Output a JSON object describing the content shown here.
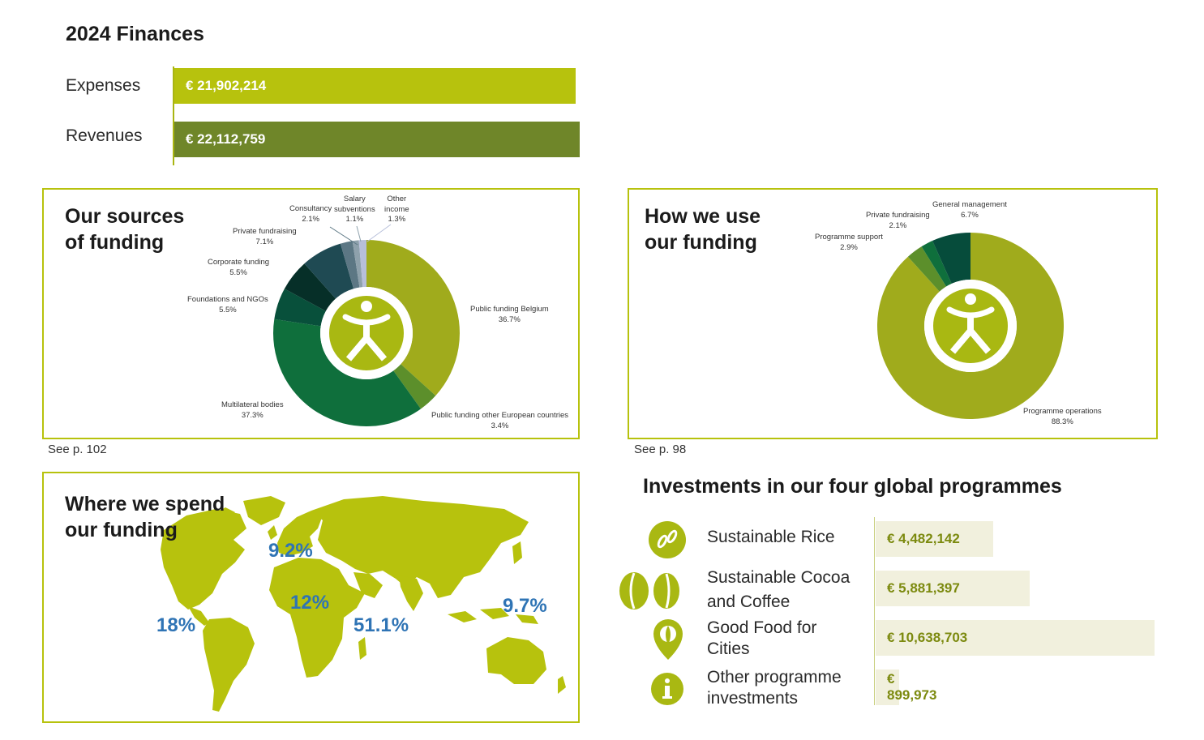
{
  "finances": {
    "title": "2024 Finances",
    "expenses_label": "Expenses",
    "expenses_value": "€ 21,902,214",
    "revenues_label": "Revenues",
    "revenues_value": "€ 22,112,759",
    "colors": {
      "expenses": "#b7c20d",
      "revenues": "#6f8629"
    }
  },
  "sources": {
    "title_line1": "Our sources",
    "title_line2": "of funding",
    "see": "See p. 102"
  },
  "use": {
    "title_line1": "How we use",
    "title_line2": "our funding",
    "see": "See p. 98"
  },
  "spend": {
    "title_line1": "Where we spend",
    "title_line2": "our funding",
    "regions": [
      {
        "name": "Americas",
        "value": "18%"
      },
      {
        "name": "Europe",
        "value": "9.2%"
      },
      {
        "name": "West Africa",
        "value": "12%"
      },
      {
        "name": "East Africa",
        "value": "51.1%"
      },
      {
        "name": "Asia",
        "value": "9.7%"
      }
    ]
  },
  "investments": {
    "title": "Investments in our four global programmes",
    "items": [
      {
        "label_line1": "Sustainable Rice",
        "label_line2": "",
        "value": "€ 4,482,142",
        "amount": 4482142,
        "icon": "rice-grain-icon"
      },
      {
        "label_line1": "Sustainable Cocoa",
        "label_line2": "and Coffee",
        "value": "€ 5,881,397",
        "amount": 5881397,
        "icon": "coffee-bean-icon"
      },
      {
        "label_line1": "Good Food for",
        "label_line2": "Cities",
        "value": "€ 10,638,703",
        "amount": 10638703,
        "icon": "location-pin-icon"
      },
      {
        "label_line1": "Other programme",
        "label_line2": "investments",
        "value": "€ 899,973",
        "amount": 899973,
        "icon": "info-icon"
      }
    ]
  },
  "chart_data": [
    {
      "type": "bar",
      "title": "2024 Finances",
      "categories": [
        "Expenses",
        "Revenues"
      ],
      "values": [
        21902214,
        22112759
      ],
      "orientation": "horizontal"
    },
    {
      "type": "pie",
      "title": "Our sources of funding",
      "slices": [
        {
          "label": "Public funding Belgium",
          "value": 36.7,
          "display": "36.7%",
          "color": "#a0ab1c"
        },
        {
          "label": "Public funding other European countries",
          "value": 3.4,
          "display": "3.4%",
          "color": "#5c8f2b"
        },
        {
          "label": "Multilateral bodies",
          "value": 37.3,
          "display": "37.3%",
          "color": "#0f6f3c"
        },
        {
          "label": "Foundations and NGOs",
          "value": 5.5,
          "display": "5.5%",
          "color": "#08503b"
        },
        {
          "label": "Corporate funding",
          "value": 5.5,
          "display": "5.5%",
          "color": "#062f28"
        },
        {
          "label": "Private fundraising",
          "value": 7.1,
          "display": "7.1%",
          "color": "#1f4a53"
        },
        {
          "label": "Consultancy",
          "value": 2.1,
          "display": "2.1%",
          "color": "#5c7784"
        },
        {
          "label": "Salary subventions",
          "value": 1.1,
          "display": "1.1%",
          "color": "#8ea1ac"
        },
        {
          "label": "Other income",
          "value": 1.3,
          "display": "1.3%",
          "color": "#b7bfda"
        }
      ]
    },
    {
      "type": "pie",
      "title": "How we use our funding",
      "slices": [
        {
          "label": "Programme operations",
          "value": 88.3,
          "display": "88.3%",
          "color": "#a0ab1c"
        },
        {
          "label": "Programme support",
          "value": 2.9,
          "display": "2.9%",
          "color": "#5c8f2b"
        },
        {
          "label": "Private fundraising",
          "value": 2.1,
          "display": "2.1%",
          "color": "#0f6f3c"
        },
        {
          "label": "General management",
          "value": 6.7,
          "display": "6.7%",
          "color": "#064c3b"
        }
      ]
    },
    {
      "type": "bar",
      "title": "Investments in our four global programmes",
      "categories": [
        "Sustainable Rice",
        "Sustainable Cocoa and Coffee",
        "Good Food for Cities",
        "Other programme investments"
      ],
      "values": [
        4482142,
        5881397,
        10638703,
        899973
      ],
      "orientation": "horizontal"
    }
  ]
}
